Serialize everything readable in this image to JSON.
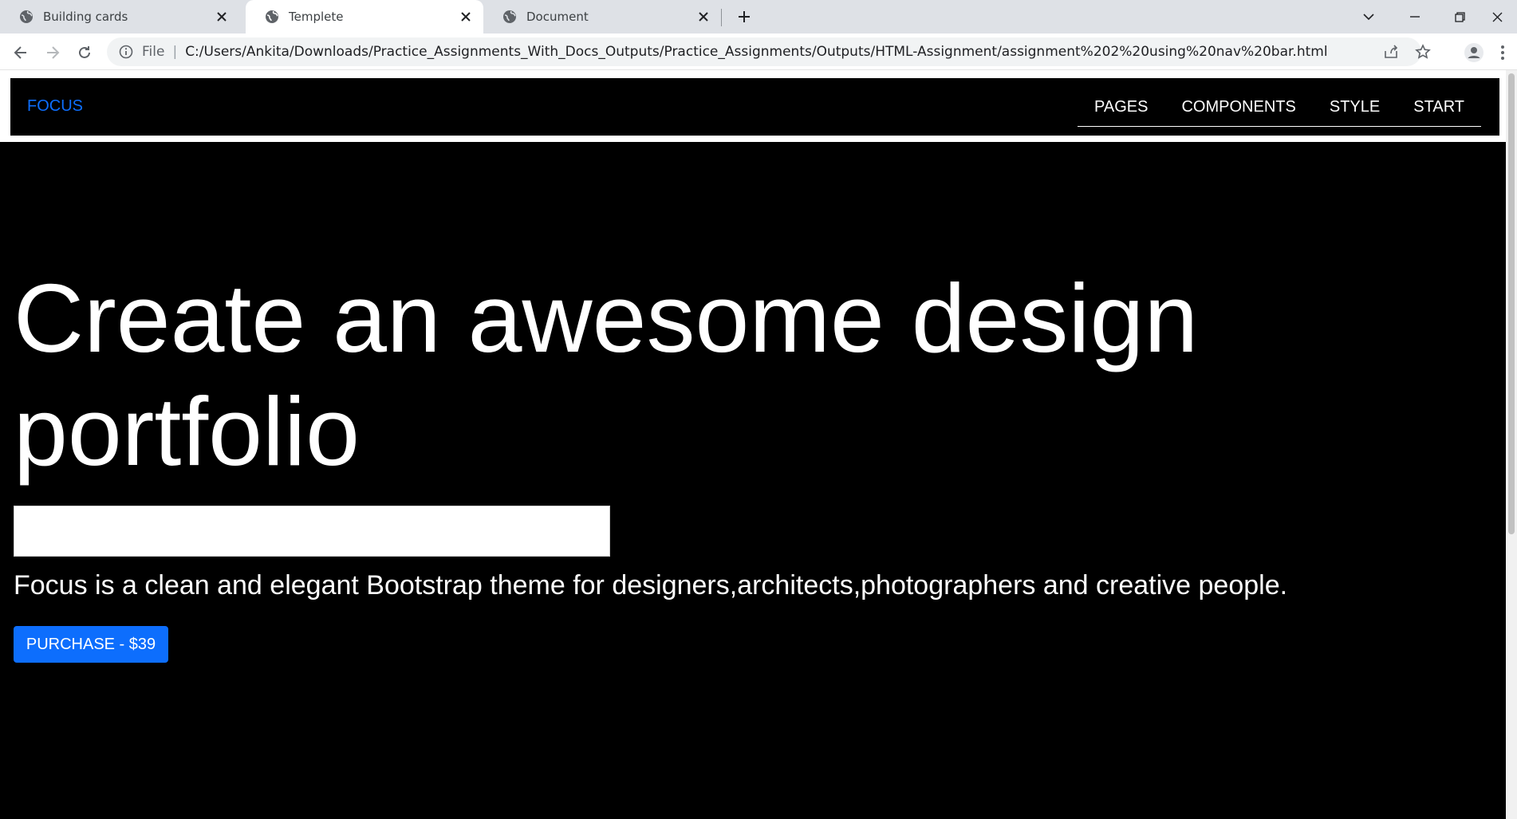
{
  "browser": {
    "tabs": [
      {
        "title": "Building cards"
      },
      {
        "title": "Templete"
      },
      {
        "title": "Document"
      }
    ],
    "address": {
      "scheme_label": "File",
      "url": "C:/Users/Ankita/Downloads/Practice_Assignments_With_Docs_Outputs/Practice_Assignments/Outputs/HTML-Assignment/assignment%202%20using%20nav%20bar.html"
    }
  },
  "navbar": {
    "brand": "FOCUS",
    "links": [
      "PAGES",
      "COMPONENTS",
      "STYLE",
      "START"
    ]
  },
  "hero": {
    "heading": "Create an awesome design portfolio",
    "input_value": "",
    "description": "Focus is a clean and elegant Bootstrap theme for designers,architects,photographers and creative people.",
    "button_label": "PURCHASE - $39"
  },
  "colors": {
    "accent": "#0d6efd",
    "page_background": "#000000",
    "text": "#ffffff",
    "tabstrip": "#dee1e6"
  }
}
